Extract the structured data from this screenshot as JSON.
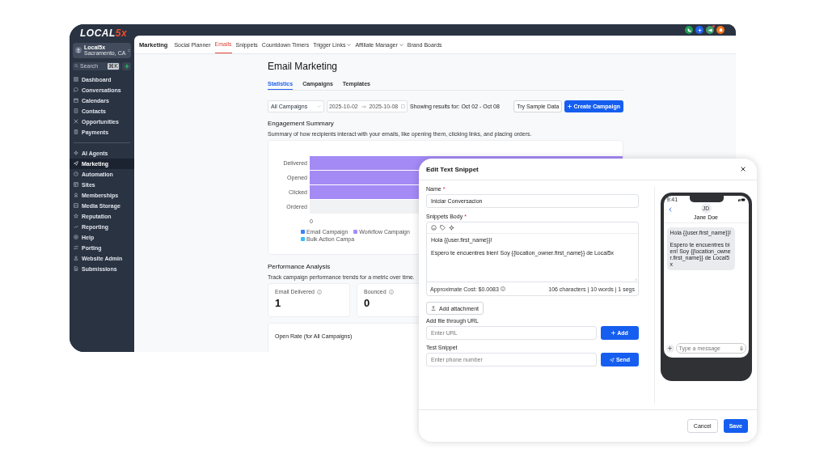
{
  "sidebar": {
    "logo": {
      "text": "LOCAL",
      "accent": "5x"
    },
    "account": {
      "name": "Local5x",
      "location": "Sacramento, CA"
    },
    "search": {
      "placeholder": "Search",
      "shortcut": "⌘K"
    },
    "groups": [
      [
        {
          "label": "Dashboard",
          "selected": false
        },
        {
          "label": "Conversations",
          "selected": false
        },
        {
          "label": "Calendars",
          "selected": false
        },
        {
          "label": "Contacts",
          "selected": false
        },
        {
          "label": "Opportunities",
          "selected": false
        },
        {
          "label": "Payments",
          "selected": false
        }
      ],
      [
        {
          "label": "AI Agents",
          "selected": false
        },
        {
          "label": "Marketing",
          "selected": true
        },
        {
          "label": "Automation",
          "selected": false
        },
        {
          "label": "Sites",
          "selected": false
        },
        {
          "label": "Memberships",
          "selected": false
        },
        {
          "label": "Media Storage",
          "selected": false
        },
        {
          "label": "Reputation",
          "selected": false
        },
        {
          "label": "Reporting",
          "selected": false
        },
        {
          "label": "Help",
          "selected": false
        },
        {
          "label": "Porting",
          "selected": false
        },
        {
          "label": "Website Admin",
          "selected": false
        },
        {
          "label": "Submissions",
          "selected": false
        }
      ]
    ]
  },
  "top_bar": {
    "buttons": [
      {
        "kind": "phone",
        "color": "#1f9d55",
        "notification": false
      },
      {
        "kind": "sparkle",
        "color": "#2563eb",
        "notification": false
      },
      {
        "kind": "megaphone",
        "color": "#3f9e6e",
        "notification": true
      },
      {
        "kind": "bell",
        "color": "#f97316",
        "notification": false
      }
    ]
  },
  "nav": {
    "title": "Marketing",
    "items": [
      {
        "label": "Social Planner",
        "selected": false,
        "dropdown": false
      },
      {
        "label": "Emails",
        "selected": true,
        "dropdown": false
      },
      {
        "label": "Snippets",
        "selected": false,
        "dropdown": false
      },
      {
        "label": "Countdown Timers",
        "selected": false,
        "dropdown": false
      },
      {
        "label": "Trigger Links",
        "selected": false,
        "dropdown": true
      },
      {
        "label": "Affiliate Manager",
        "selected": false,
        "dropdown": true
      },
      {
        "label": "Brand Boards",
        "selected": false,
        "dropdown": false
      }
    ]
  },
  "page": {
    "title": "Email Marketing",
    "tabs": [
      {
        "label": "Statistics",
        "selected": true
      },
      {
        "label": "Campaigns",
        "selected": false
      },
      {
        "label": "Templates",
        "selected": false
      }
    ],
    "filters": {
      "campaign": "All Campaigns",
      "date_from": "2025-10-02",
      "date_to": "2025-10-08",
      "results": "Showing results for: Oct 02 - Oct 08",
      "sample_button": "Try Sample Data",
      "create_button": "Create Campaign"
    },
    "engagement": {
      "title": "Engagement Summary",
      "description": "Summary of how recipients interact with your emails, like opening them, clicking links, and placing orders.",
      "rows": [
        {
          "label": "Delivered",
          "filled": true
        },
        {
          "label": "Opened",
          "filled": true
        },
        {
          "label": "Clicked",
          "filled": true
        },
        {
          "label": "Ordered",
          "filled": false
        }
      ],
      "axis_tick": "0",
      "legend": [
        {
          "label": "Email Campaign",
          "color": "#3b82f6"
        },
        {
          "label": "Workflow Campaign",
          "color": "#a78bfa"
        },
        {
          "label": "Bulk Action Campa",
          "color": "#38bdf8"
        }
      ]
    },
    "performance": {
      "title": "Performance Analysis",
      "description": "Track campaign performance trends for a metric over time.",
      "cards": [
        {
          "label": "Email Delivered",
          "value": "1"
        },
        {
          "label": "Bounced",
          "value": "0"
        }
      ],
      "open_rate": "Open Rate (for All Campaigns)"
    }
  },
  "modal": {
    "title": "Edit Text Snippet",
    "name": {
      "label": "Name",
      "mark": "*",
      "value": "Iniciar Conversacion"
    },
    "body": {
      "label": "Snippets Body",
      "mark": "*",
      "paragraphs": [
        "Hola {{user.first_name}}!",
        "Espero te encuentres bien! Soy {{location_owner.first_name}} de Local5x"
      ],
      "cost": "Approximate Cost: $0.0083",
      "counter": "106 characters | 10 words | 1 segs"
    },
    "attachment_button": "Add attachment",
    "url": {
      "label": "Add file through URL",
      "placeholder": "Enter URL",
      "button": "Add"
    },
    "test": {
      "label": "Test Snippet",
      "placeholder": "Enter phone number",
      "button": "Send"
    },
    "phone": {
      "time": "9:41",
      "initials": "JD",
      "contact": "Jane Doe",
      "message": [
        "Hola {{user.first_name}}!",
        "Espero te encuentres bien! Soy {{location_owner.first_name}} de Local5x"
      ],
      "input_placeholder": "Type a message"
    },
    "cancel": "Cancel",
    "save": "Save"
  }
}
